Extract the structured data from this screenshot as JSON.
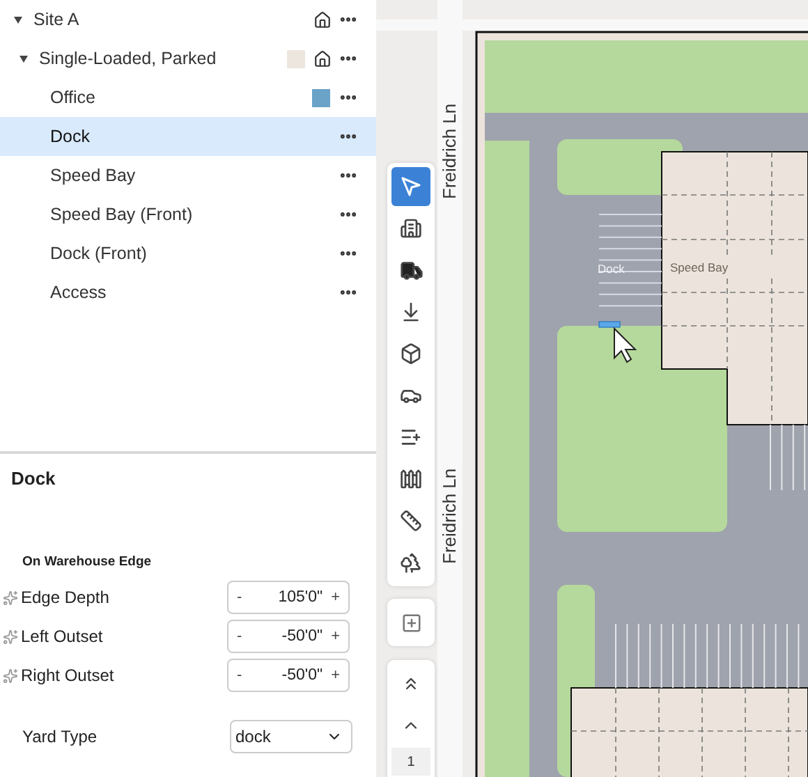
{
  "tree": [
    {
      "label": "Site A",
      "expanded": true,
      "selected": false,
      "children": [
        {
          "label": "Single-Loaded, Parked",
          "expanded": true,
          "selected": false,
          "color": "#ede6df",
          "children": [
            {
              "label": "Office",
              "selected": false,
              "color": "#6aa2c8"
            },
            {
              "label": "Dock",
              "selected": true
            },
            {
              "label": "Speed Bay",
              "selected": false
            },
            {
              "label": "Speed Bay (Front)",
              "selected": false
            },
            {
              "label": "Dock (Front)",
              "selected": false
            },
            {
              "label": "Access",
              "selected": false
            }
          ]
        }
      ]
    }
  ],
  "properties": {
    "title": "Dock",
    "section": "On Warehouse Edge",
    "fields": [
      {
        "label": "Edge Depth",
        "value": "105'0\"",
        "minus": "-",
        "plus": "+"
      },
      {
        "label": "Left Outset",
        "value": "-50'0\"",
        "minus": "-",
        "plus": "+"
      },
      {
        "label": "Right Outset",
        "value": "-50'0\"",
        "minus": "-",
        "plus": "+"
      }
    ],
    "yard_type": {
      "label": "Yard Type",
      "value": "dock"
    }
  },
  "map": {
    "streets": [
      "Freidrich Ln",
      "Freidrich Ln"
    ],
    "labels": [
      "Dock",
      "Speed Bay"
    ]
  },
  "tools": [
    {
      "selected": true
    },
    {
      "selected": false
    },
    {
      "selected": false
    },
    {
      "selected": false
    },
    {
      "selected": false
    },
    {
      "selected": false
    },
    {
      "selected": false
    },
    {
      "selected": false
    },
    {
      "selected": false
    },
    {
      "selected": false
    }
  ],
  "pager": {
    "page": "1"
  }
}
